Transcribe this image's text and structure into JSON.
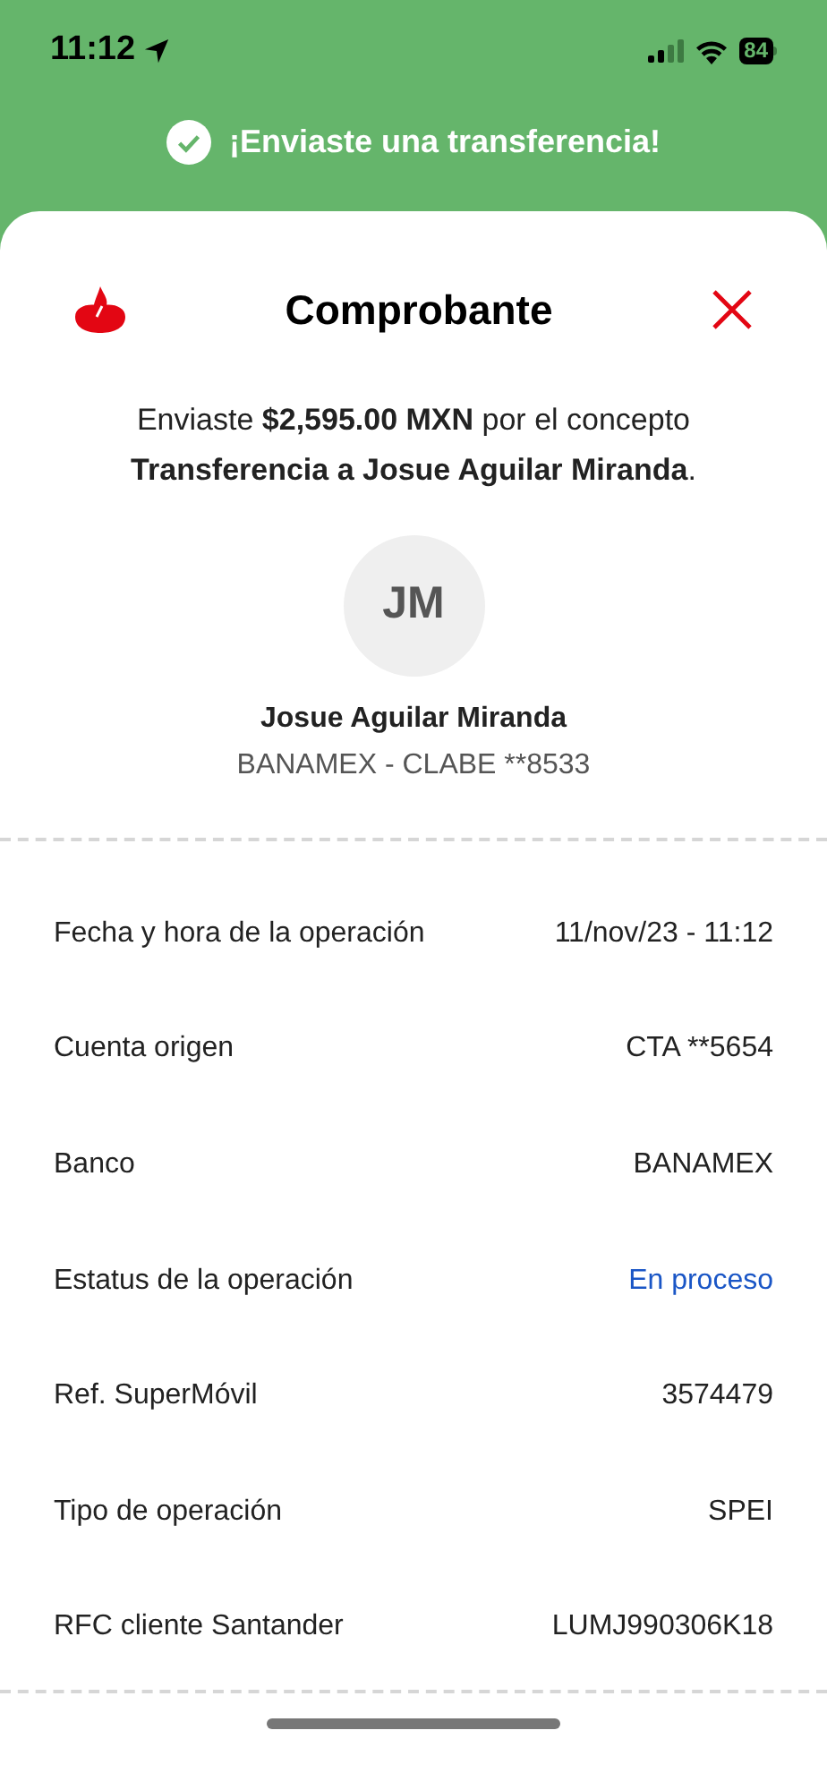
{
  "status_bar": {
    "time": "11:12",
    "battery": "84"
  },
  "banner": {
    "text": "¡Enviaste una transferencia!"
  },
  "receipt": {
    "title": "Comprobante",
    "message": "Enviaste  **$2,595.00 MXN** por el concepto **Transferencia a Josue Aguilar Miranda**.",
    "recipient": {
      "initials": "JM",
      "name": "Josue Aguilar Miranda",
      "account": "BANAMEX - CLABE **8533"
    },
    "details": [
      {
        "label": "Fecha y hora de la operación",
        "value": "11/nov/23 - 11:12",
        "kind": "plain"
      },
      {
        "label": "Cuenta origen",
        "value": "CTA **5654",
        "kind": "plain"
      },
      {
        "label": "Banco",
        "value": "BANAMEX",
        "kind": "plain"
      },
      {
        "label": "Estatus de la operación",
        "value": "En proceso",
        "kind": "status"
      },
      {
        "label": "Ref. SuperMóvil",
        "value": "3574479",
        "kind": "plain"
      },
      {
        "label": "Tipo de operación",
        "value": "SPEI",
        "kind": "plain"
      },
      {
        "label": "RFC cliente Santander",
        "value": "LUMJ990306K18",
        "kind": "plain"
      }
    ]
  }
}
